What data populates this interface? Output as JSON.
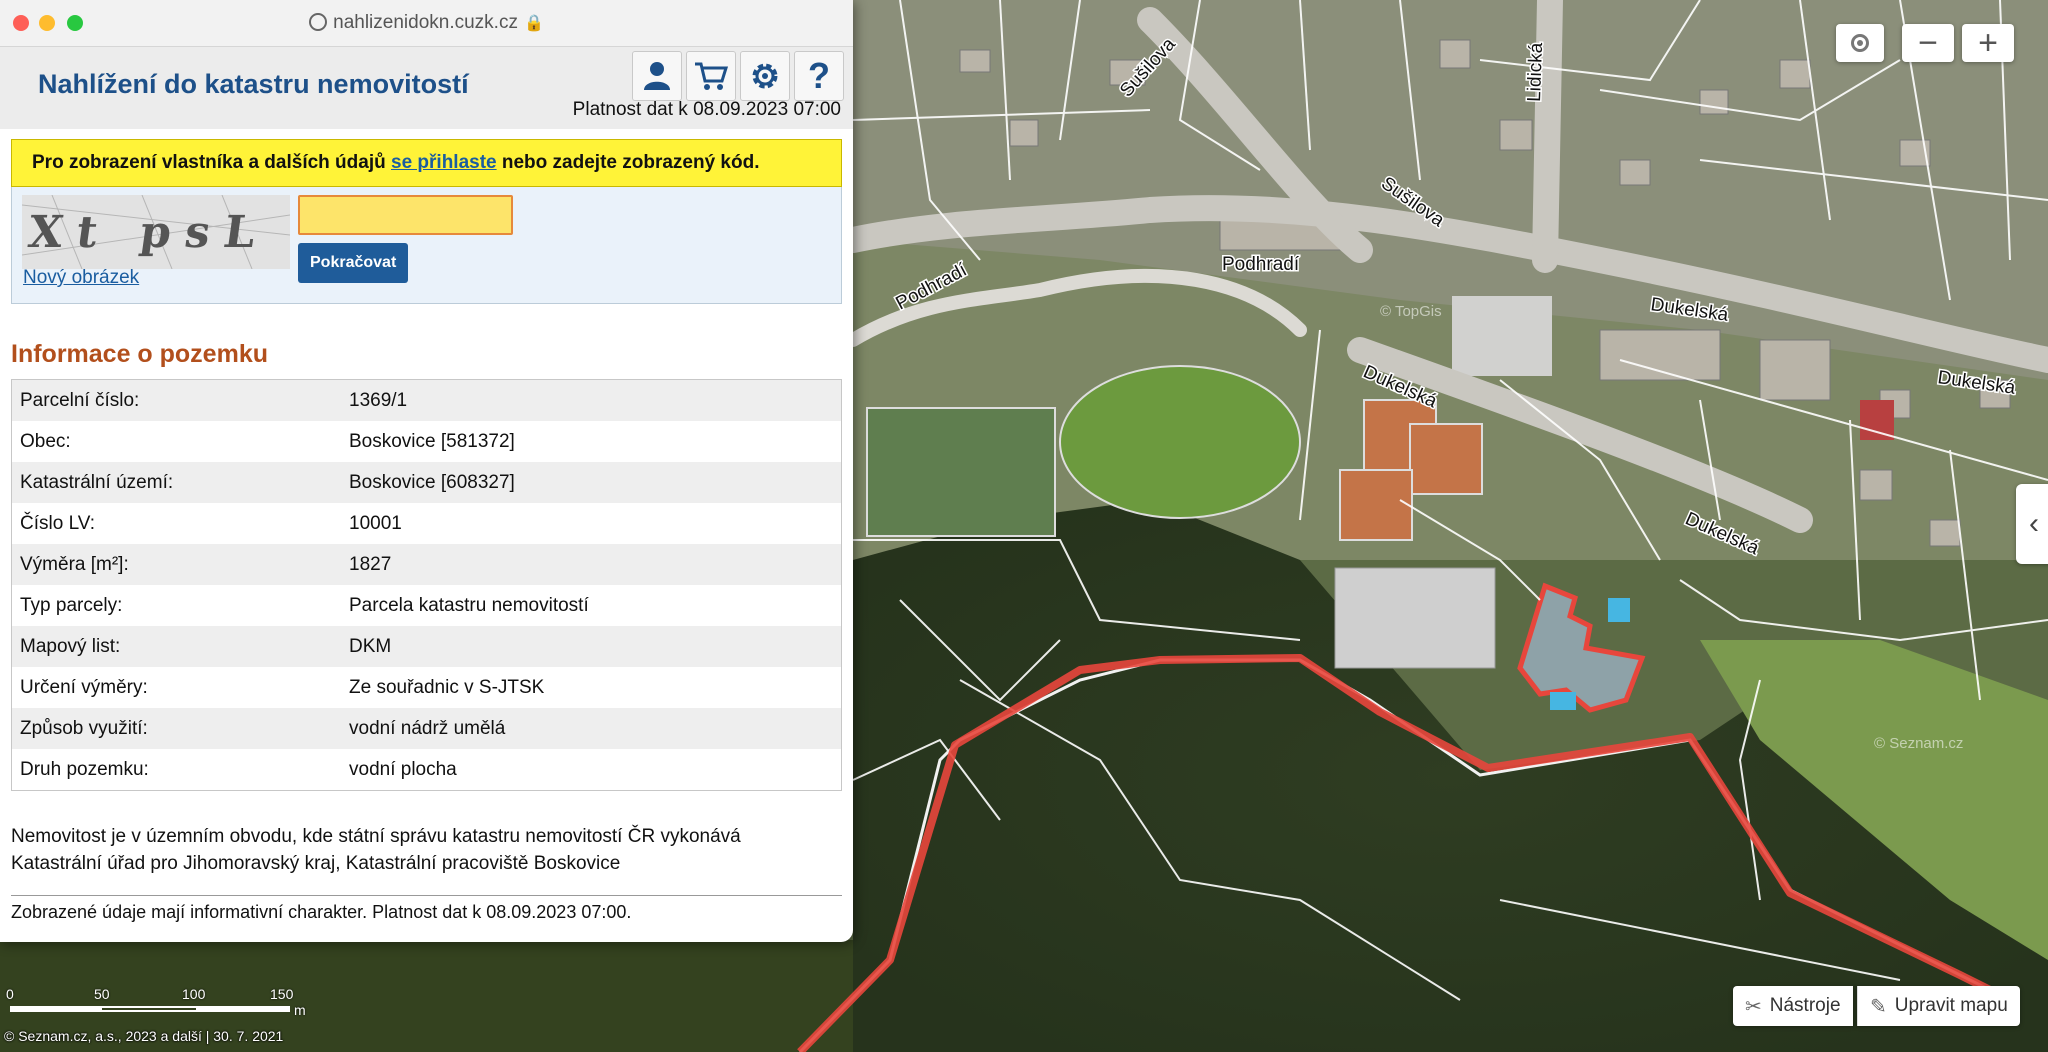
{
  "browser": {
    "url": "nahlizenidokn.cuzk.cz"
  },
  "header": {
    "title": "Nahlížení do katastru nemovitostí",
    "validity": "Platnost dat k 08.09.2023 07:00",
    "icons": [
      "user-icon",
      "cart-icon",
      "gear-icon",
      "help-icon"
    ]
  },
  "notice": {
    "prefix": "Pro zobrazení vlastníka a dalších údajů ",
    "link": "se přihlaste",
    "suffix": " nebo zadejte zobrazený kód."
  },
  "captcha": {
    "image_text": "Xt psL",
    "new_image": "Nový obrázek",
    "code_value": "",
    "continue_label": "Pokračovat"
  },
  "info": {
    "title": "Informace o pozemku",
    "rows": [
      {
        "key": "Parcelní číslo:",
        "value": "1369/1"
      },
      {
        "key": "Obec:",
        "value": "Boskovice [581372]"
      },
      {
        "key": "Katastrální území:",
        "value": "Boskovice [608327]"
      },
      {
        "key": "Číslo LV:",
        "value": "10001"
      },
      {
        "key": "Výměra [m²]:",
        "value": "1827"
      },
      {
        "key": "Typ parcely:",
        "value": "Parcela katastru nemovitostí"
      },
      {
        "key": "Mapový list:",
        "value": "DKM"
      },
      {
        "key": "Určení výměry:",
        "value": "Ze souřadnic v S-JTSK"
      },
      {
        "key": "Způsob využití:",
        "value": "vodní nádrž umělá"
      },
      {
        "key": "Druh pozemku:",
        "value": "vodní plocha"
      }
    ],
    "office_line1": "Nemovitost je v územním obvodu, kde státní správu katastru nemovitostí ČR vykonává",
    "office_line2": "Katastrální úřad pro Jihomoravský kraj, Katastrální pracoviště Boskovice",
    "footer": "Zobrazené údaje mají informativní charakter. Platnost dat k 08.09.2023 07:00."
  },
  "map": {
    "streets": [
      "Sušilova",
      "Sušilova",
      "Lidická",
      "Podhradí",
      "Podhradí",
      "Dukelská",
      "Dukelská",
      "Dukelská",
      "Dukelská"
    ],
    "watermark": "© TopGis",
    "watermark2": "© Seznam.cz",
    "zoom_out": "−",
    "zoom_in": "+",
    "side_toggle": "‹",
    "tools": "Nástroje",
    "edit": "Upravit mapu",
    "scale": {
      "labels": [
        "0",
        "50",
        "100",
        "150"
      ],
      "unit": "m"
    },
    "copyright": "© Seznam.cz, a.s., 2023 a další | 30. 7. 2021",
    "highlight_color": "#e8463c"
  }
}
